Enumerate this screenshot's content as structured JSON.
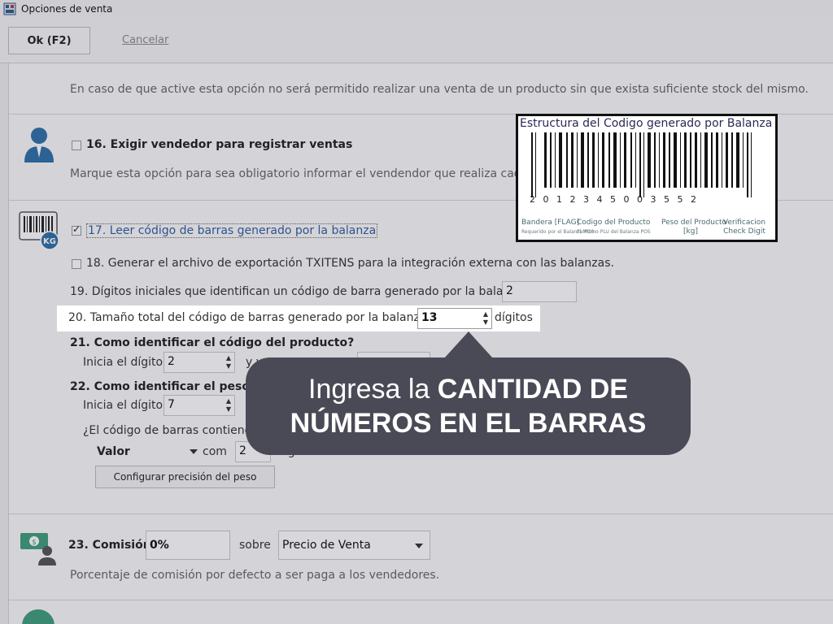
{
  "window": {
    "title": "Opciones de venta"
  },
  "toolbar": {
    "ok_label": "Ok (F2)",
    "cancel_label": "Cancelar"
  },
  "stock": {
    "description": "En caso de que active esta opción no será permitido realizar una venta de un producto sin que exista suficiente stock del mismo."
  },
  "opt16": {
    "title": "16. Exigir vendedor para registrar ventas",
    "checked": false,
    "description": "Marque esta opción para sea obligatorio informar el vendendor que realiza cada ve"
  },
  "opt17": {
    "title": "17. Leer código de barras generado por la balanza",
    "checked": true,
    "icon_badge": "KG"
  },
  "opt18": {
    "label": "18. Generar el archivo de exportación TXITENS para la integración externa con las balanzas.",
    "checked": false
  },
  "opt19": {
    "label": "19. Dígitos iniciales que identifican un código de barra generado por la balanza:",
    "value": "2"
  },
  "opt20": {
    "label": "20. Tamaño total del código de barras generado por la balanza:",
    "value": "13",
    "suffix": "dígitos"
  },
  "opt21": {
    "title": "21. Como identificar el código del producto?",
    "start_label": "Inicia el dígito",
    "start_value": "2",
    "and_label": "y v"
  },
  "opt22": {
    "title": "22. Como identificar el peso o val",
    "start_label": "Inicia el dígito",
    "start_value": "7",
    "decimals_question": "¿El código de barras contiene",
    "type_value": "Valor",
    "with_label": "com",
    "decimals_value": "2",
    "decimals_suffix": "dígitos decimales",
    "config_button": "Configurar precisión del peso"
  },
  "opt23": {
    "title": "23. Comisión",
    "value": "0%",
    "over_label": "sobre",
    "base_value": "Precio de Venta",
    "description": "Porcentaje de comisión por defecto a ser paga a los vendedores."
  },
  "barcode_diagram": {
    "title": "Estructura del Codigo generado por Balanza",
    "digits": "2  0  1  2  3  4  5  0  0  3  5  5  2",
    "labels": {
      "flag": "Bandera [FLAG]",
      "flag_sub": "Requerido por el Balanza POS",
      "product": "Codigo del Producto",
      "product_sub": "El Mismo PLU del Balanza POS",
      "weight": "Peso del Producto",
      "weight_sub": "[kg]",
      "check": "Verificacion",
      "check_sub": "Check Digit"
    }
  },
  "callout": {
    "text_regular": "Ingresa la ",
    "text_bold": "CANTIDAD DE NÚMEROS EN EL BARRAS"
  }
}
